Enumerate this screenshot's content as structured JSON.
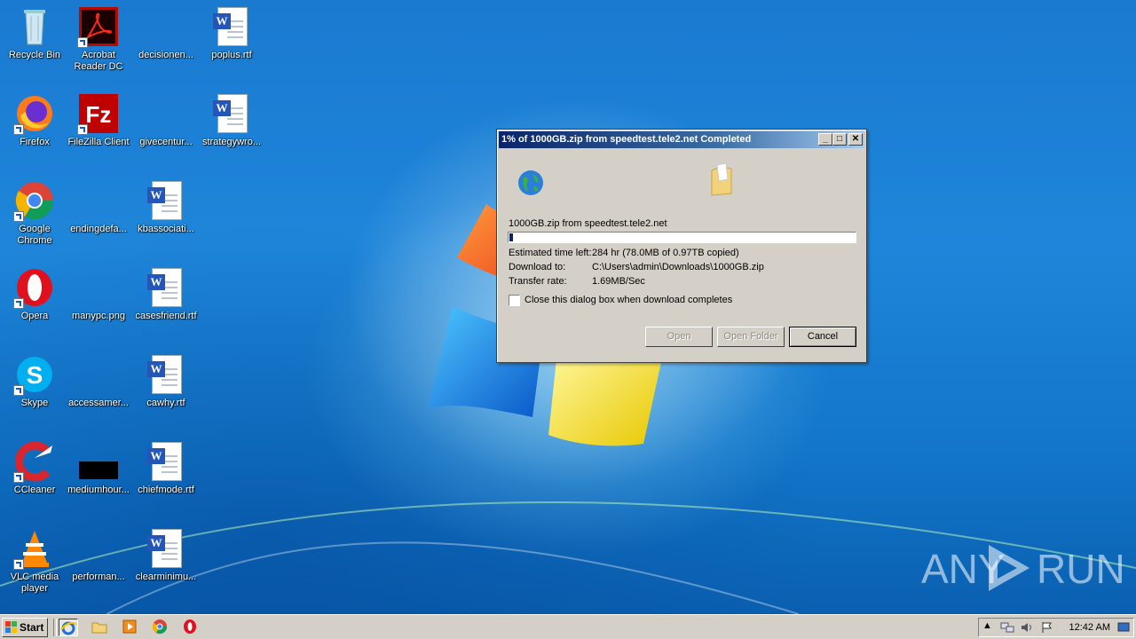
{
  "desktop": {
    "icons": [
      {
        "label": "Recycle Bin",
        "icon": "recycle-bin-icon"
      },
      {
        "label": "Acrobat Reader DC",
        "icon": "acrobat-icon"
      },
      {
        "label": "decisionen...",
        "icon": "blank-file-icon"
      },
      {
        "label": "poplus.rtf",
        "icon": "word-document-icon"
      },
      {
        "label": "Firefox",
        "icon": "firefox-icon"
      },
      {
        "label": "FileZilla Client",
        "icon": "filezilla-icon"
      },
      {
        "label": "givecentur...",
        "icon": "blank-file-icon"
      },
      {
        "label": "strategywro...",
        "icon": "word-document-icon"
      },
      {
        "label": "Google Chrome",
        "icon": "chrome-icon"
      },
      {
        "label": "endingdefa...",
        "icon": "blank-file-icon"
      },
      {
        "label": "kbassociati...",
        "icon": "word-document-icon"
      },
      {
        "label": "Opera",
        "icon": "opera-icon"
      },
      {
        "label": "manypc.png",
        "icon": "blank-file-icon"
      },
      {
        "label": "casesfriend.rtf",
        "icon": "word-document-icon"
      },
      {
        "label": "Skype",
        "icon": "skype-icon"
      },
      {
        "label": "accessamer...",
        "icon": "blank-file-icon"
      },
      {
        "label": "cawhy.rtf",
        "icon": "word-document-icon"
      },
      {
        "label": "CCleaner",
        "icon": "ccleaner-icon"
      },
      {
        "label": "mediumhour...",
        "icon": "black-image-icon"
      },
      {
        "label": "chiefmode.rtf",
        "icon": "word-document-icon"
      },
      {
        "label": "VLC media player",
        "icon": "vlc-icon"
      },
      {
        "label": "performan...",
        "icon": "blank-file-icon"
      },
      {
        "label": "clearminimu...",
        "icon": "word-document-icon"
      }
    ]
  },
  "dialog": {
    "title": "1% of 1000GB.zip from speedtest.tele2.net Completed",
    "file_label": "1000GB.zip from speedtest.tele2.net",
    "progress_percent": 1,
    "rows": [
      {
        "key": "Estimated time left:",
        "value": "284 hr (78.0MB of 0.97TB copied)"
      },
      {
        "key": "Download to:",
        "value": "C:\\Users\\admin\\Downloads\\1000GB.zip"
      },
      {
        "key": "Transfer rate:",
        "value": "1.69MB/Sec"
      }
    ],
    "checkbox_label": "Close this dialog box when download completes",
    "checkbox_checked": false,
    "buttons": {
      "open": "Open",
      "open_folder": "Open Folder",
      "cancel": "Cancel"
    }
  },
  "taskbar": {
    "start_label": "Start",
    "quick_launch": [
      "internet-explorer-icon",
      "folder-icon",
      "media-player-icon",
      "chrome-icon",
      "opera-icon"
    ],
    "clock": "12:42 AM"
  },
  "watermark": {
    "left": "ANY",
    "right": "RUN"
  },
  "colors": {
    "title_bar": "#0a246a",
    "dialog_face": "#d4d0c8",
    "desktop": "#1e86da"
  }
}
